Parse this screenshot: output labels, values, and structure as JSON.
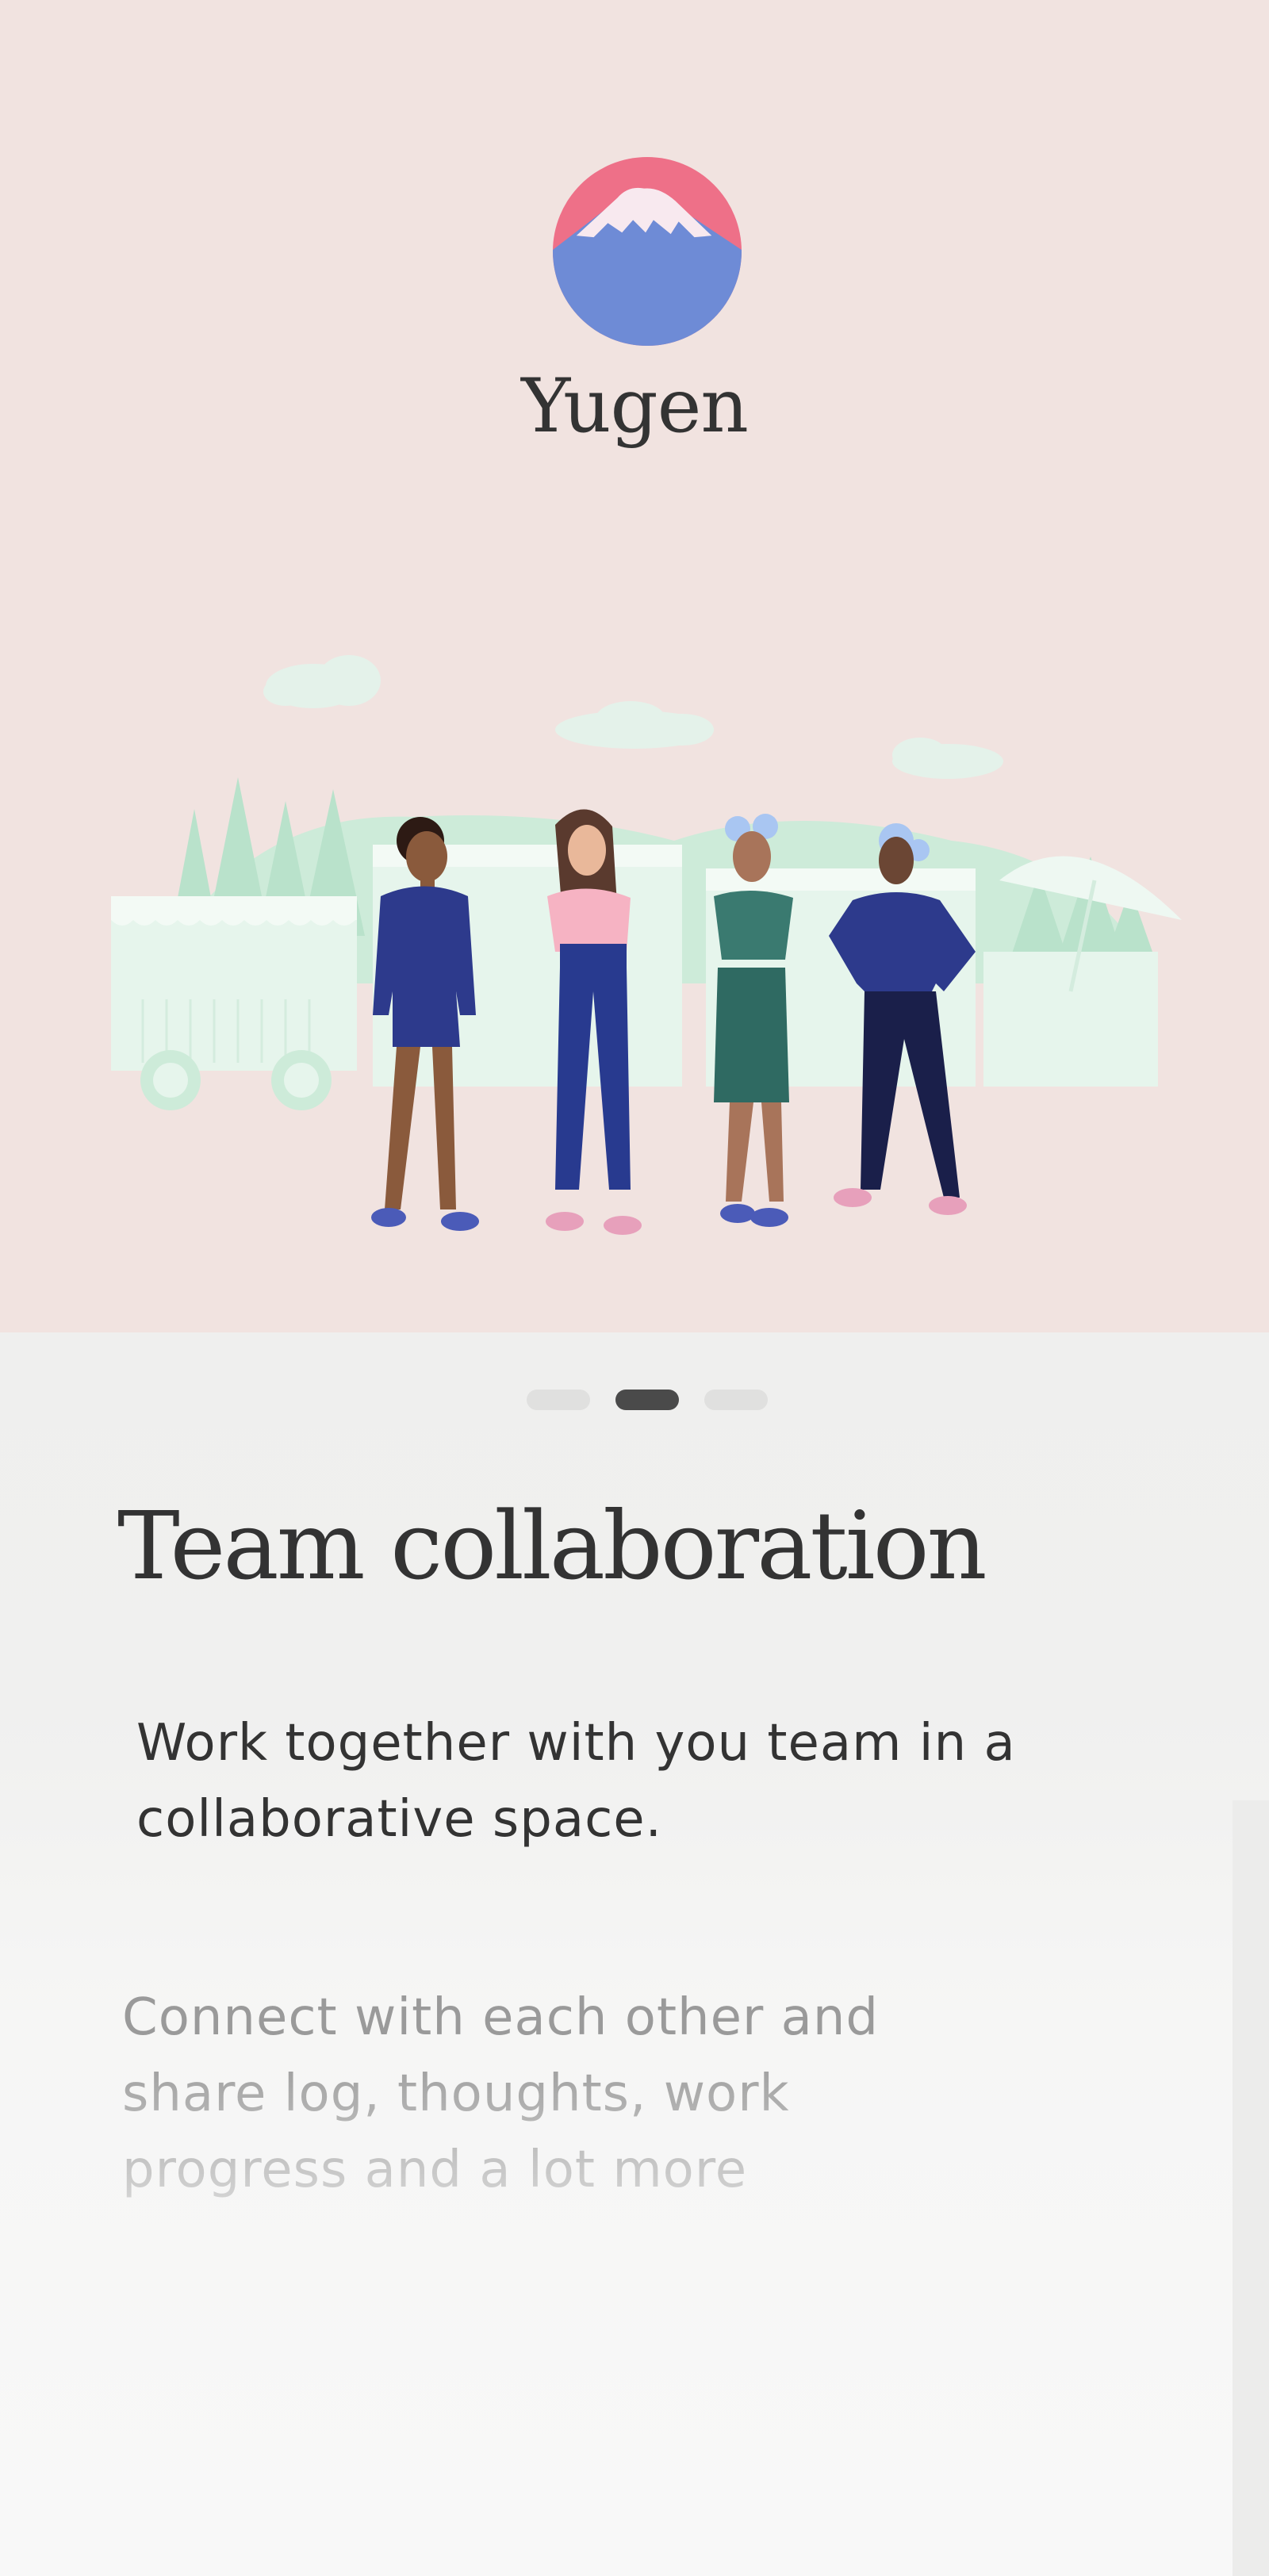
{
  "brand": {
    "name": "Yugen",
    "logo_icon": "mount-fuji-icon"
  },
  "onboarding": {
    "current_step": 2,
    "total_steps": 3,
    "title": "Team collaboration",
    "lead": "Work together with you team in a collaborative space.",
    "description_lines": [
      "Connect with each other and",
      "share log, thoughts, work",
      "progress and a lot more"
    ]
  },
  "colors": {
    "hero_background": "#f1e3e0",
    "logo_sky": "#ee7088",
    "logo_mountain": "#6e8bd6",
    "active_dot": "#4a4a4a",
    "inactive_dot": "#e0e0df",
    "text_dark": "#333333",
    "text_muted": "#9a9a9a"
  }
}
